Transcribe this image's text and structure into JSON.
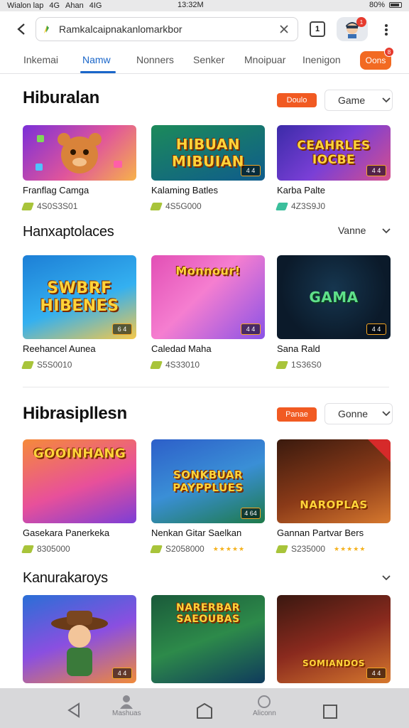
{
  "status_bar": {
    "carrier": "Wialon lap",
    "network": "4G",
    "app": "Ahan",
    "signal": "4IG",
    "time": "13:32M",
    "battery": "80%"
  },
  "browser": {
    "url": "Ramkalcaipnakanlomarkbor",
    "tab_count": "1",
    "avatar_badge": "1"
  },
  "tabs": [
    {
      "label": "Inkemai"
    },
    {
      "label": "Namw"
    },
    {
      "label": "Nonners"
    },
    {
      "label": "Senker"
    },
    {
      "label": "Mnoipuar"
    },
    {
      "label": "Inenigon"
    }
  ],
  "tab_cta": {
    "label": "Oons",
    "badge": "8"
  },
  "sections": [
    {
      "title": "Hiburalan",
      "pill": "Doulo",
      "dropdown": "Game",
      "cards": [
        {
          "name": "Franflag Camga",
          "meta": "4S0S3S01",
          "thumb_text": "",
          "badge": ""
        },
        {
          "name": "Kalaming Batles",
          "meta": "4S5G000",
          "thumb_text": "HIBUAN MIBUIAN",
          "badge": "4 4"
        },
        {
          "name": "Karba Palte",
          "meta": "4Z3S9J0",
          "thumb_text": "CEAHRLES IOCBE",
          "badge": "4 4"
        }
      ]
    },
    {
      "title": "Hanxaptolaces",
      "dropdown": "Vanne",
      "cards": [
        {
          "name": "Reehancel Aunea",
          "meta": "S5S0010",
          "thumb_text": "SWBRF HIBENES",
          "badge": "6 4"
        },
        {
          "name": "Caledad Maha",
          "meta": "4S33010",
          "thumb_text": "Monnour!",
          "badge": "4 4"
        },
        {
          "name": "Sana Rald",
          "meta": "1S36S0",
          "thumb_text": "GAMA",
          "badge": "4 4"
        }
      ]
    },
    {
      "title": "Hibrasipllesn",
      "pill": "Panae",
      "dropdown": "Gonne",
      "cards": [
        {
          "name": "Gasekara Panerkeka",
          "meta": "8305000",
          "thumb_text": "GOOINHANG",
          "badge": "",
          "stars": ""
        },
        {
          "name": "Nenkan Gitar Saelkan",
          "meta": "S2058000",
          "thumb_text": "SONKBUAR PAYPPLUES",
          "badge": "4 64",
          "stars": "★★★★★"
        },
        {
          "name": "Gannan Partvar Bers",
          "meta": "S235000",
          "thumb_text": "NAROPLAS",
          "badge": "",
          "stars": "★★★★★"
        }
      ]
    },
    {
      "title": "Kanurakaroys",
      "cards": [
        {
          "name": "",
          "meta": "",
          "thumb_text": "",
          "badge": "4 4"
        },
        {
          "name": "",
          "meta": "",
          "thumb_text": "NARERBAR SAEOUBAS",
          "badge": ""
        },
        {
          "name": "",
          "meta": "",
          "thumb_text": "SOMIANDOS",
          "badge": "4 4"
        }
      ]
    }
  ],
  "bottom_nav": [
    {
      "label": "",
      "icon": "back-triangle-icon"
    },
    {
      "label": "Mashuas",
      "icon": "person-icon"
    },
    {
      "label": "",
      "icon": "home-icon"
    },
    {
      "label": "Aliconn",
      "icon": "circle-icon"
    },
    {
      "label": "",
      "icon": "square-icon"
    }
  ],
  "colors": {
    "accent": "#1a66c9",
    "brand_orange": "#f15a22"
  }
}
